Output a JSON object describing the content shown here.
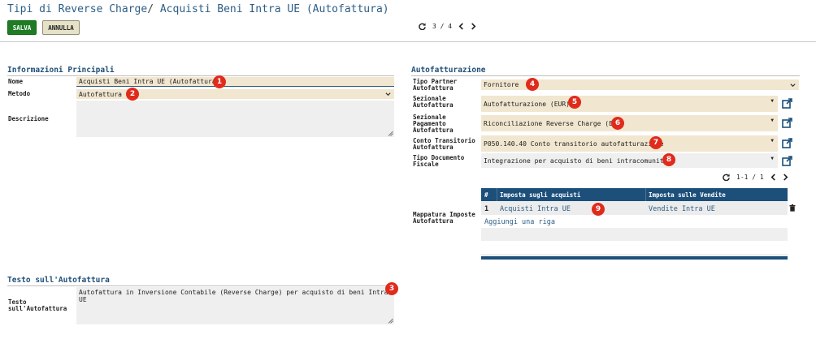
{
  "breadcrumb": {
    "parent": "Tipi di Reverse Charge",
    "separator": "/",
    "current": "Acquisti Beni Intra UE (Autofattura)"
  },
  "toolbar": {
    "save_label": "SALVA",
    "cancel_label": "ANNULLA"
  },
  "pager": {
    "value": "3 / 4"
  },
  "main_section": {
    "title": "Informazioni Principali",
    "nome_label": "Nome",
    "nome_value": "Acquisti Beni Intra UE (Autofattura)",
    "metodo_label": "Metodo",
    "metodo_value": "Autofattura",
    "descrizione_label": "Descrizione",
    "descrizione_value": ""
  },
  "auto_section": {
    "title": "Autofatturazione",
    "partner_label": "Tipo Partner Autofattura",
    "partner_value": "Fornitore",
    "sezionale_label": "Sezionale Autofattura",
    "sezionale_value": "Autofatturazione (EUR)",
    "sez_pag_label": "Sezionale Pagamento Autofattura",
    "sez_pag_value": "Riconciliazione Reverse Charge (EUR)",
    "conto_label": "Conto Transitorio Autofattura",
    "conto_value": "P050.140.40 Conto transitorio autofatturazione",
    "tipo_doc_label": "Tipo Documento Fiscale",
    "tipo_doc_value": "Integrazione per acquisto di beni intracomunitari",
    "mappatura_label": "Mappatura Imposte Autofattura"
  },
  "tax_table": {
    "pager": "1-1 / 1",
    "headers": [
      "#",
      "Imposta sugli acquisti",
      "Imposta sulle Vendite"
    ],
    "rows": [
      {
        "num": "1",
        "acquisti": "Acquisti Intra UE",
        "vendite": "Vendite Intra UE"
      }
    ],
    "add_line": "Aggiungi una riga"
  },
  "text_section": {
    "title": "Testo sull'Autofattura",
    "label": "Testo sull'Autofattura",
    "value": "Autofattura in Inversione Contabile (Reverse Charge) per acquisto di beni Intra UE"
  },
  "badges": [
    "1",
    "2",
    "3",
    "4",
    "5",
    "6",
    "7",
    "8",
    "9"
  ],
  "colors": {
    "primary": "#1e7d22",
    "accent": "#2c5d86",
    "badge": "#e02b1c",
    "required_field": "#f1e6cf",
    "table_header": "#1c4f7a"
  },
  "icons": [
    "refresh-icon",
    "chevron-left-icon",
    "chevron-right-icon",
    "caret-down-icon",
    "external-link-icon",
    "trash-icon",
    "resize-handle-icon"
  ]
}
